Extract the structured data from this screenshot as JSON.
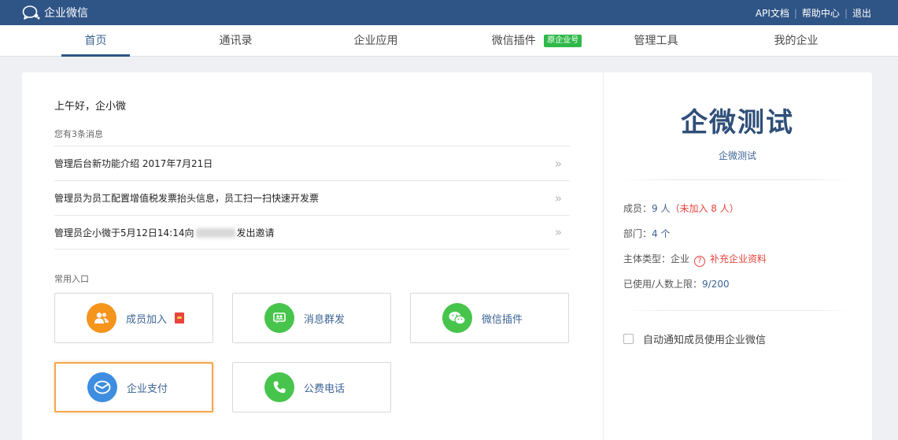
{
  "app": {
    "title": "企业微信"
  },
  "toplinks": {
    "api_docs": "API文档",
    "help": "帮助中心",
    "logout": "退出"
  },
  "nav": {
    "items": [
      {
        "label": "首页",
        "active": true
      },
      {
        "label": "通讯录"
      },
      {
        "label": "企业应用"
      },
      {
        "label": "微信插件",
        "badge": "原企业号"
      },
      {
        "label": "管理工具"
      },
      {
        "label": "我的企业"
      }
    ]
  },
  "home": {
    "greeting": "上午好，企小微",
    "message_count": "您有3条消息",
    "messages": [
      {
        "text": "管理后台新功能介绍 2017年7月21日"
      },
      {
        "text": "管理员为员工配置增值税发票抬头信息，员工扫一扫快速开发票"
      },
      {
        "text_before": "管理员企小微于5月12日14:14向",
        "text_after": "发出邀请"
      }
    ],
    "arrow": "»",
    "common_label": "常用入口",
    "entries": [
      {
        "label": "成员加入",
        "icon": "members-icon",
        "color": "#f5951c"
      },
      {
        "label": "消息群发",
        "icon": "broadcast-icon",
        "color": "#47c44c"
      },
      {
        "label": "微信插件",
        "icon": "wechat-icon",
        "color": "#47c44c"
      },
      {
        "label": "企业支付",
        "icon": "payment-icon",
        "color": "#3e8de0",
        "selected": true
      },
      {
        "label": "公费电话",
        "icon": "phone-icon",
        "color": "#47c44c"
      }
    ]
  },
  "company": {
    "name": "企微测试",
    "sub": "企微测试",
    "members_label": "成员：",
    "members_value": "9 人",
    "members_unjoined": "（未加入 8 人）",
    "departments_label": "部门：",
    "departments_value": "4 个",
    "type_label": "主体类型：",
    "type_value": "企业",
    "type_help": "?",
    "supplement_link": "补充企业资料",
    "quota_label": "已使用/人数上限：",
    "quota_value": "9/200",
    "notify_label": "自动通知成员使用企业微信"
  },
  "colors": {
    "topbar": "#2f5486",
    "accent": "#3d6494",
    "warning": "#e8453c",
    "badge": "#2fb949",
    "selected_border": "#f4a64c"
  }
}
